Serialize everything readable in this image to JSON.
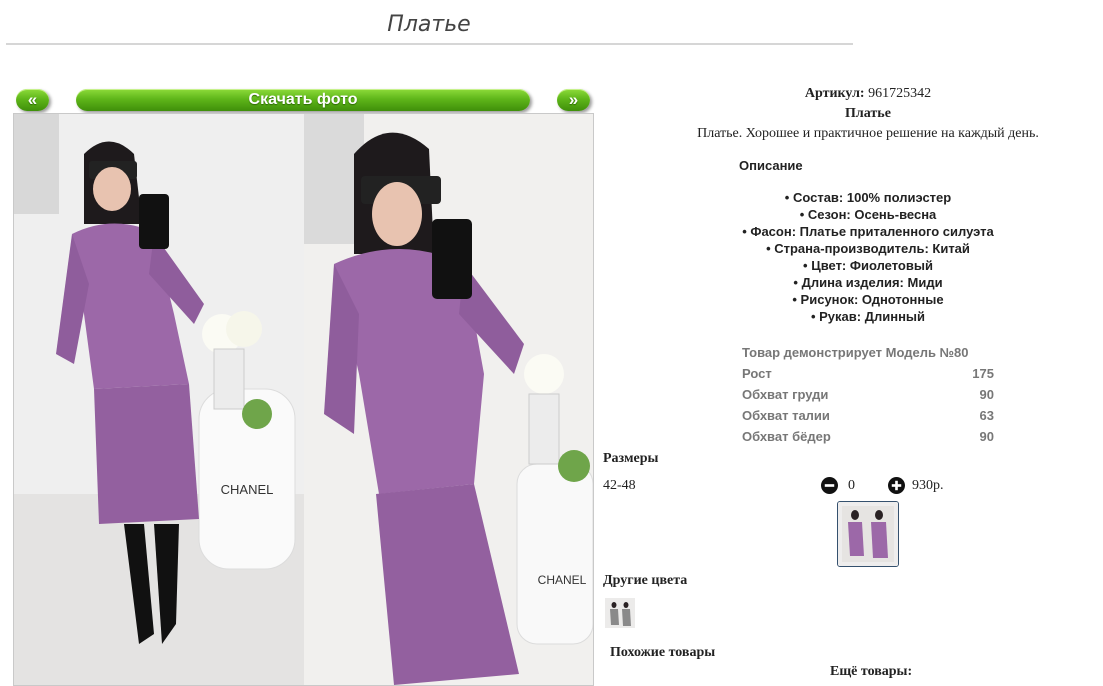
{
  "page": {
    "title": "Платье"
  },
  "gallery": {
    "prev_label": "«",
    "next_label": "»",
    "download_label": "Скачать фото"
  },
  "product": {
    "sku_label": "Артикул:",
    "sku_value": "961725342",
    "name": "Платье",
    "description": "Платье. Хорошее и практичное решение на каждый день."
  },
  "details": {
    "heading": "Описание",
    "specs": [
      "• Состав: 100% полиэстер",
      "• Сезон: Осень-весна",
      "• Фасон: Платье приталенного силуэта",
      "• Страна-производитель: Китай",
      "• Цвет: Фиолетовый",
      "• Длина изделия: Миди",
      "• Рисунок: Однотонные",
      "• Рукав: Длинный"
    ]
  },
  "model": {
    "caption": "Товар демонстрирует Модель №80",
    "rows": [
      {
        "label": "Рост",
        "value": "175"
      },
      {
        "label": "Обхват груди",
        "value": "90"
      },
      {
        "label": "Обхват талии",
        "value": "63"
      },
      {
        "label": "Обхват бёдер",
        "value": "90"
      }
    ]
  },
  "sizes": {
    "heading": "Размеры",
    "size": "42-48",
    "quantity": "0",
    "price": "930р."
  },
  "other_colors": {
    "heading": "Другие цвета"
  },
  "similar": {
    "heading": "Похожие товары"
  },
  "more": {
    "heading": "Ещё товары:"
  },
  "colors": {
    "button_green": "#5fb61a",
    "dress_purple": "#9c68a8",
    "thumb_border": "#35516e",
    "muted_text": "#777777"
  }
}
